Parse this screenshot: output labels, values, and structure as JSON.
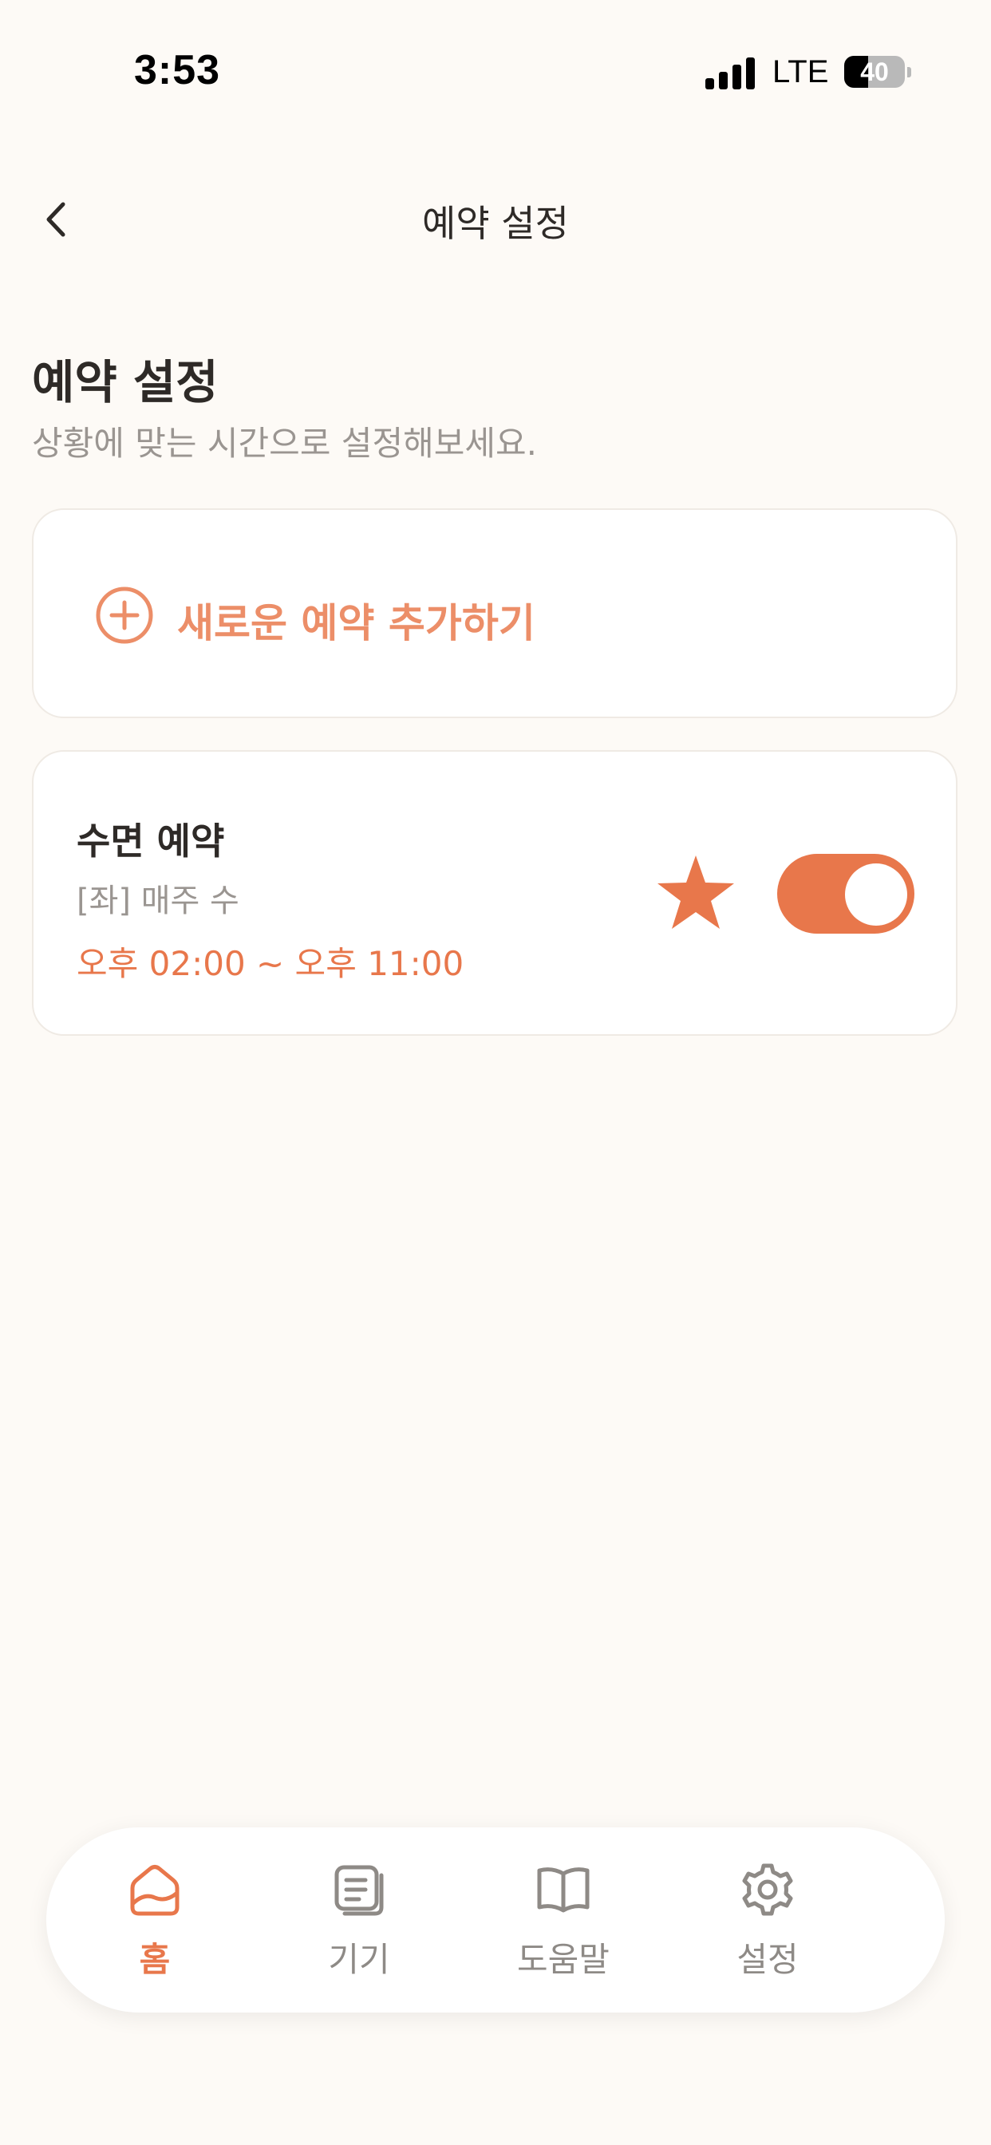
{
  "status_bar": {
    "time": "3:53",
    "network": "LTE",
    "battery_level": "40",
    "battery_fraction": 0.4
  },
  "header": {
    "title": "예약 설정"
  },
  "page": {
    "title": "예약 설정",
    "subtitle": "상황에 맞는 시간으로 설정해보세요."
  },
  "add_card": {
    "label": "새로운 예약 추가하기"
  },
  "reservation": {
    "title": "수면 예약",
    "detail": "[좌] 매주 수",
    "time": "오후 02:00 ~ 오후 11:00",
    "favorite": true,
    "enabled": true
  },
  "tabs": [
    {
      "label": "홈",
      "icon": "home-icon",
      "active": true
    },
    {
      "label": "기기",
      "icon": "device-icon",
      "active": false
    },
    {
      "label": "도움말",
      "icon": "book-icon",
      "active": false
    },
    {
      "label": "설정",
      "icon": "gear-icon",
      "active": false
    }
  ],
  "colors": {
    "accent": "#E8774B",
    "accent_light": "#EC8E68",
    "background": "#FDFAF6",
    "muted_text": "#9A9591",
    "primary_text": "#2E2A27"
  }
}
